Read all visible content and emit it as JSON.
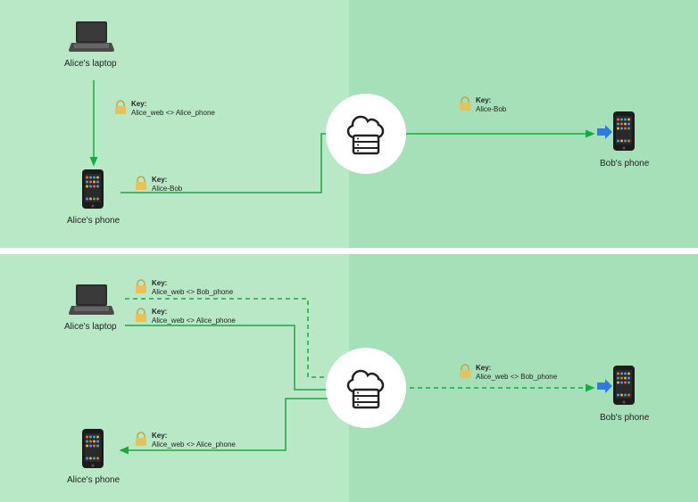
{
  "top": {
    "alice_laptop": "Alice's laptop",
    "alice_phone": "Alice's phone",
    "bob_phone": "Bob's phone",
    "key1": {
      "title": "Key:",
      "value": "Alice_web <> Alice_phone"
    },
    "key2": {
      "title": "Key:",
      "value": "Alice-Bob"
    },
    "key3": {
      "title": "Key:",
      "value": "Alice-Bob"
    }
  },
  "bottom": {
    "alice_laptop": "Alice's laptop",
    "alice_phone": "Alice's phone",
    "bob_phone": "Bob's phone",
    "key1": {
      "title": "Key:",
      "value": "Alice_web <> Bob_phone"
    },
    "key2": {
      "title": "Key:",
      "value": "Alice_web <> Alice_phone"
    },
    "key3": {
      "title": "Key:",
      "value": "Alice_web <> Alice_phone"
    },
    "key4": {
      "title": "Key:",
      "value": "Alice_web <> Bob_phone"
    }
  }
}
